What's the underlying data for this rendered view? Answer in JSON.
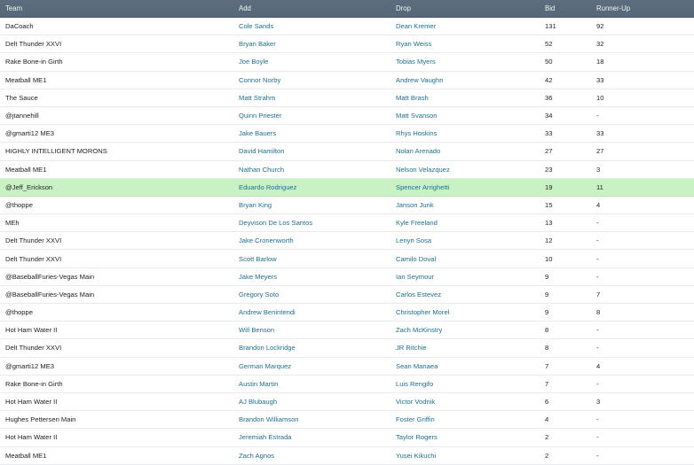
{
  "header": {
    "team": "Team",
    "add": "Add",
    "drop": "Drop",
    "bid": "Bid",
    "runner_up": "Runner-Up"
  },
  "highlight_color": "#c8f2c4",
  "link_color": "#1f6f8f",
  "header_color": "#5d6d7e",
  "rows": [
    {
      "team": "DaCoach",
      "add": "Cole Sands",
      "drop": "Dean Kremer",
      "bid": "131",
      "runner_up": "92"
    },
    {
      "team": "Delt Thunder XXVI",
      "add": "Bryan Baker",
      "drop": "Ryan Weiss",
      "bid": "52",
      "runner_up": "32"
    },
    {
      "team": "Rake Bone-in Girth",
      "add": "Joe Boyle",
      "drop": "Tobias Myers",
      "bid": "50",
      "runner_up": "18"
    },
    {
      "team": "Meatball ME1",
      "add": "Connor Norby",
      "drop": "Andrew Vaughn",
      "bid": "42",
      "runner_up": "33"
    },
    {
      "team": "The Sauce",
      "add": "Matt Strahm",
      "drop": "Matt Brash",
      "bid": "36",
      "runner_up": "10"
    },
    {
      "team": "@jtannehill",
      "add": "Quinn Priester",
      "drop": "Matt Svanson",
      "bid": "34",
      "runner_up": "-"
    },
    {
      "team": "@gmarti12 ME3",
      "add": "Jake Bauers",
      "drop": "Rhys Hoskins",
      "bid": "33",
      "runner_up": "33"
    },
    {
      "team": "HIGHLY INTELLIGENT MORONS",
      "add": "David Hamilton",
      "drop": "Nolan Arenado",
      "bid": "27",
      "runner_up": "27"
    },
    {
      "team": "Meatball ME1",
      "add": "Nathan Church",
      "drop": "Nelson Velazquez",
      "bid": "23",
      "runner_up": "3"
    },
    {
      "team": "@Jeff_Erickson",
      "add": "Eduardo Rodriguez",
      "drop": "Spencer Arrighetti",
      "bid": "19",
      "runner_up": "11",
      "highlight": true
    },
    {
      "team": "@thoppe",
      "add": "Bryan King",
      "drop": "Janson Junk",
      "bid": "15",
      "runner_up": "4"
    },
    {
      "team": "MEh",
      "add": "Deyvison De Los Santos",
      "drop": "Kyle Freeland",
      "bid": "13",
      "runner_up": "-"
    },
    {
      "team": "Delt Thunder XXVI",
      "add": "Jake Cronenworth",
      "drop": "Lenyn Sosa",
      "bid": "12",
      "runner_up": "-"
    },
    {
      "team": "Delt Thunder XXVI",
      "add": "Scott Barlow",
      "drop": "Camilo Doval",
      "bid": "10",
      "runner_up": "-"
    },
    {
      "team": "@BaseballFuries-Vegas Main",
      "add": "Jake Meyers",
      "drop": "Ian Seymour",
      "bid": "9",
      "runner_up": "-"
    },
    {
      "team": "@BaseballFuries-Vegas Main",
      "add": "Gregory Soto",
      "drop": "Carlos Estevez",
      "bid": "9",
      "runner_up": "7"
    },
    {
      "team": "@thoppe",
      "add": "Andrew Benintendi",
      "drop": "Christopher Morel",
      "bid": "9",
      "runner_up": "8"
    },
    {
      "team": "Hot Ham Water II",
      "add": "Will Benson",
      "drop": "Zach McKinstry",
      "bid": "8",
      "runner_up": "-"
    },
    {
      "team": "Delt Thunder XXVI",
      "add": "Brandon Lockridge",
      "drop": "JR Ritchie",
      "bid": "8",
      "runner_up": "-"
    },
    {
      "team": "@gmarti12 ME3",
      "add": "German Marquez",
      "drop": "Sean Manaea",
      "bid": "7",
      "runner_up": "4"
    },
    {
      "team": "Rake Bone-in Girth",
      "add": "Austin Martin",
      "drop": "Luis Rengifo",
      "bid": "7",
      "runner_up": "-"
    },
    {
      "team": "Hot Ham Water II",
      "add": "AJ Blubaugh",
      "drop": "Victor Vodnik",
      "bid": "6",
      "runner_up": "3"
    },
    {
      "team": "Hughes Pettersen Main",
      "add": "Brandon Williamson",
      "drop": "Foster Griffin",
      "bid": "4",
      "runner_up": "-"
    },
    {
      "team": "Hot Ham Water II",
      "add": "Jeremiah Estrada",
      "drop": "Taylor Rogers",
      "bid": "2",
      "runner_up": "-"
    },
    {
      "team": "Meatball ME1",
      "add": "Zach Agnos",
      "drop": "Yusei Kikuchi",
      "bid": "2",
      "runner_up": "-"
    }
  ]
}
